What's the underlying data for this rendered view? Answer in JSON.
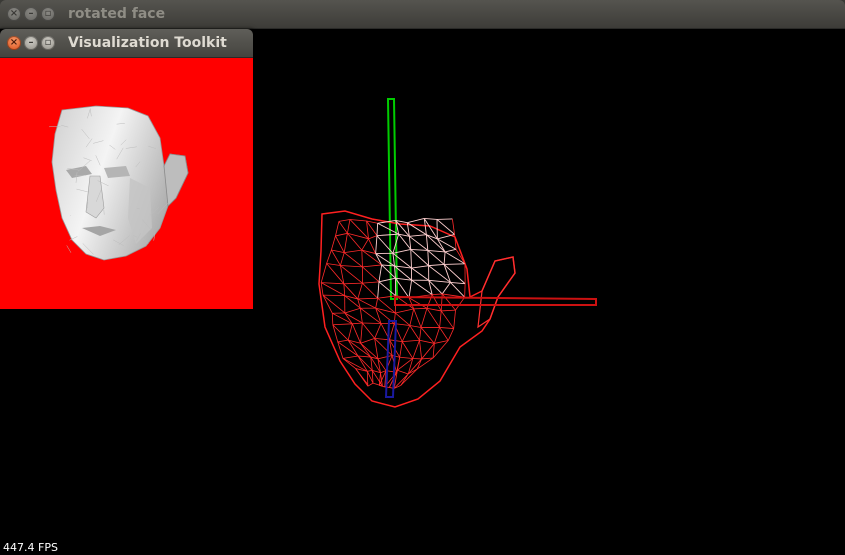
{
  "main_window": {
    "title": "rotated face",
    "buttons": {
      "close": "×",
      "minimize": "–",
      "maximize": "▫"
    },
    "fps": "447.4 FPS",
    "background_color": "#000000",
    "wireframe_color": "#ff2020",
    "axes": {
      "x_color": "#cc1111",
      "y_color": "#00cc00",
      "z_color": "#1a1aa0"
    }
  },
  "vtk_window": {
    "title": "Visualization Toolkit",
    "buttons": {
      "close": "×",
      "minimize": "–",
      "maximize": "▫"
    },
    "background_color": "#ff0000",
    "face_color": "#e8e8e8"
  }
}
